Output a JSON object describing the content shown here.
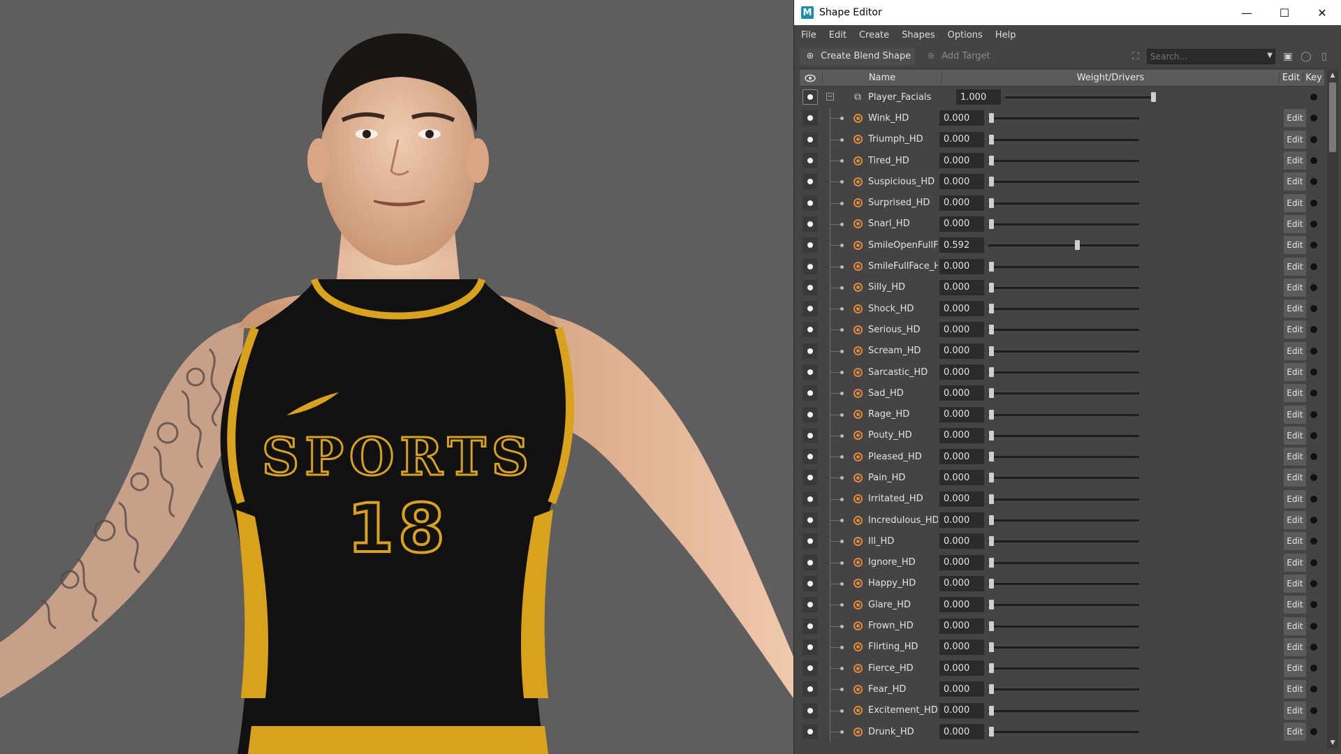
{
  "window": {
    "title": "Shape Editor",
    "app_icon": "M",
    "controls": {
      "minimize": "—",
      "maximize": "☐",
      "close": "✕"
    }
  },
  "menu": [
    "File",
    "Edit",
    "Create",
    "Shapes",
    "Options",
    "Help"
  ],
  "toolbar": {
    "create_blend_shape": "Create Blend Shape",
    "add_target": "Add Target",
    "search_placeholder": "Search..."
  },
  "columns": {
    "name": "Name",
    "weight": "Weight/Drivers",
    "edit": "Edit",
    "key": "Key"
  },
  "edit_label": "Edit",
  "jersey": {
    "text": "SPORTS",
    "number": "18"
  },
  "root": {
    "name": "Player_Facials",
    "value": "1.000",
    "weight": 1.0
  },
  "targets": [
    {
      "name": "Wink_HD",
      "value": "0.000",
      "weight": 0.0
    },
    {
      "name": "Triumph_HD",
      "value": "0.000",
      "weight": 0.0
    },
    {
      "name": "Tired_HD",
      "value": "0.000",
      "weight": 0.0
    },
    {
      "name": "Suspicious_HD",
      "value": "0.000",
      "weight": 0.0
    },
    {
      "name": "Surprised_HD",
      "value": "0.000",
      "weight": 0.0
    },
    {
      "name": "Snarl_HD",
      "value": "0.000",
      "weight": 0.0
    },
    {
      "name": "SmileOpenFullFa",
      "value": "0.592",
      "weight": 0.592
    },
    {
      "name": "SmileFullFace_H",
      "value": "0.000",
      "weight": 0.0
    },
    {
      "name": "Silly_HD",
      "value": "0.000",
      "weight": 0.0
    },
    {
      "name": "Shock_HD",
      "value": "0.000",
      "weight": 0.0
    },
    {
      "name": "Serious_HD",
      "value": "0.000",
      "weight": 0.0
    },
    {
      "name": "Scream_HD",
      "value": "0.000",
      "weight": 0.0
    },
    {
      "name": "Sarcastic_HD",
      "value": "0.000",
      "weight": 0.0
    },
    {
      "name": "Sad_HD",
      "value": "0.000",
      "weight": 0.0
    },
    {
      "name": "Rage_HD",
      "value": "0.000",
      "weight": 0.0
    },
    {
      "name": "Pouty_HD",
      "value": "0.000",
      "weight": 0.0
    },
    {
      "name": "Pleased_HD",
      "value": "0.000",
      "weight": 0.0
    },
    {
      "name": "Pain_HD",
      "value": "0.000",
      "weight": 0.0
    },
    {
      "name": "Irritated_HD",
      "value": "0.000",
      "weight": 0.0
    },
    {
      "name": "Incredulous_HD",
      "value": "0.000",
      "weight": 0.0
    },
    {
      "name": "Ill_HD",
      "value": "0.000",
      "weight": 0.0
    },
    {
      "name": "Ignore_HD",
      "value": "0.000",
      "weight": 0.0
    },
    {
      "name": "Happy_HD",
      "value": "0.000",
      "weight": 0.0
    },
    {
      "name": "Glare_HD",
      "value": "0.000",
      "weight": 0.0
    },
    {
      "name": "Frown_HD",
      "value": "0.000",
      "weight": 0.0
    },
    {
      "name": "Flirting_HD",
      "value": "0.000",
      "weight": 0.0
    },
    {
      "name": "Fierce_HD",
      "value": "0.000",
      "weight": 0.0
    },
    {
      "name": "Fear_HD",
      "value": "0.000",
      "weight": 0.0
    },
    {
      "name": "Excitement_HD",
      "value": "0.000",
      "weight": 0.0
    },
    {
      "name": "Drunk_HD",
      "value": "0.000",
      "weight": 0.0
    }
  ],
  "colors": {
    "jersey": "#111111",
    "trim": "#d9a21b",
    "skin": "#e3b896",
    "accent": "#e28a3c"
  }
}
